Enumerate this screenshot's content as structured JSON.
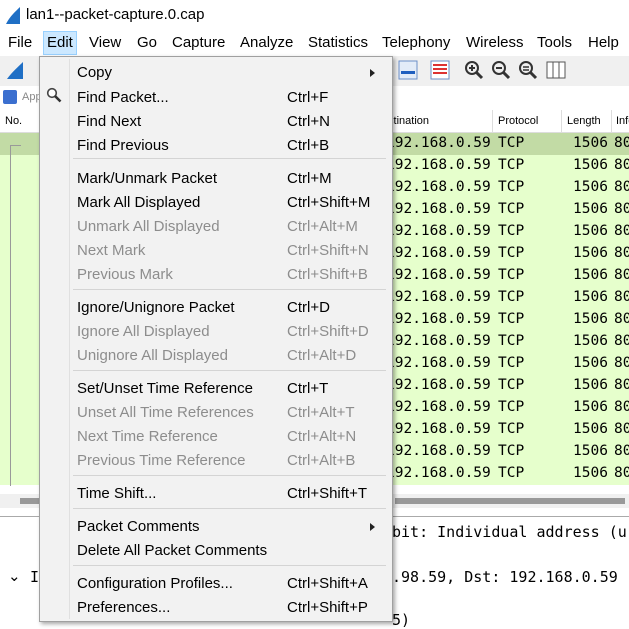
{
  "window": {
    "title": "lan1--packet-capture.0.cap"
  },
  "menubar": [
    "File",
    "Edit",
    "View",
    "Go",
    "Capture",
    "Analyze",
    "Statistics",
    "Telephony",
    "Wireless",
    "Tools",
    "Help"
  ],
  "filter": {
    "placeholder": "App"
  },
  "columns": {
    "no": "No.",
    "destination": "Destination",
    "protocol": "Protocol",
    "length": "Length",
    "info": "Info"
  },
  "packets": [
    {
      "dst": "192.168.0.59",
      "proto": "TCP",
      "len": "1506",
      "info": "80"
    },
    {
      "dst": "192.168.0.59",
      "proto": "TCP",
      "len": "1506",
      "info": "80"
    },
    {
      "dst": "192.168.0.59",
      "proto": "TCP",
      "len": "1506",
      "info": "80"
    },
    {
      "dst": "192.168.0.59",
      "proto": "TCP",
      "len": "1506",
      "info": "80"
    },
    {
      "dst": "192.168.0.59",
      "proto": "TCP",
      "len": "1506",
      "info": "80"
    },
    {
      "dst": "192.168.0.59",
      "proto": "TCP",
      "len": "1506",
      "info": "80"
    },
    {
      "dst": "192.168.0.59",
      "proto": "TCP",
      "len": "1506",
      "info": "80"
    },
    {
      "dst": "192.168.0.59",
      "proto": "TCP",
      "len": "1506",
      "info": "80"
    },
    {
      "dst": "192.168.0.59",
      "proto": "TCP",
      "len": "1506",
      "info": "80"
    },
    {
      "dst": "192.168.0.59",
      "proto": "TCP",
      "len": "1506",
      "info": "80"
    },
    {
      "dst": "192.168.0.59",
      "proto": "TCP",
      "len": "1506",
      "info": "80"
    },
    {
      "dst": "192.168.0.59",
      "proto": "TCP",
      "len": "1506",
      "info": "80"
    },
    {
      "dst": "192.168.0.59",
      "proto": "TCP",
      "len": "1506",
      "info": "80"
    },
    {
      "dst": "192.168.0.59",
      "proto": "TCP",
      "len": "1506",
      "info": "80"
    },
    {
      "dst": "192.168.0.59",
      "proto": "TCP",
      "len": "1506",
      "info": "80"
    },
    {
      "dst": "192.168.0.59",
      "proto": "TCP",
      "len": "1506",
      "info": "80"
    }
  ],
  "detail": {
    "line1": "bit: Individual address (u",
    "line2": "I",
    "line3": ".98.59, Dst: 192.168.0.59",
    "line4": "5)"
  },
  "edit_menu": [
    {
      "label": "Copy",
      "shortcut": "",
      "disabled": false,
      "submenu": true
    },
    {
      "label": "Find Packet...",
      "shortcut": "Ctrl+F",
      "disabled": false,
      "icon": "magnifier-icon"
    },
    {
      "label": "Find Next",
      "shortcut": "Ctrl+N",
      "disabled": false
    },
    {
      "label": "Find Previous",
      "shortcut": "Ctrl+B",
      "disabled": false
    },
    {
      "label": "Mark/Unmark Packet",
      "shortcut": "Ctrl+M",
      "disabled": false
    },
    {
      "label": "Mark All Displayed",
      "shortcut": "Ctrl+Shift+M",
      "disabled": false
    },
    {
      "label": "Unmark All Displayed",
      "shortcut": "Ctrl+Alt+M",
      "disabled": true
    },
    {
      "label": "Next Mark",
      "shortcut": "Ctrl+Shift+N",
      "disabled": true
    },
    {
      "label": "Previous Mark",
      "shortcut": "Ctrl+Shift+B",
      "disabled": true
    },
    {
      "label": "Ignore/Unignore Packet",
      "shortcut": "Ctrl+D",
      "disabled": false
    },
    {
      "label": "Ignore All Displayed",
      "shortcut": "Ctrl+Shift+D",
      "disabled": true
    },
    {
      "label": "Unignore All Displayed",
      "shortcut": "Ctrl+Alt+D",
      "disabled": true
    },
    {
      "label": "Set/Unset Time Reference",
      "shortcut": "Ctrl+T",
      "disabled": false
    },
    {
      "label": "Unset All Time References",
      "shortcut": "Ctrl+Alt+T",
      "disabled": true
    },
    {
      "label": "Next Time Reference",
      "shortcut": "Ctrl+Alt+N",
      "disabled": true
    },
    {
      "label": "Previous Time Reference",
      "shortcut": "Ctrl+Alt+B",
      "disabled": true
    },
    {
      "label": "Time Shift...",
      "shortcut": "Ctrl+Shift+T",
      "disabled": false
    },
    {
      "label": "Packet Comments",
      "shortcut": "",
      "disabled": false,
      "submenu": true
    },
    {
      "label": "Delete All Packet Comments",
      "shortcut": "",
      "disabled": false
    },
    {
      "label": "Configuration Profiles...",
      "shortcut": "Ctrl+Shift+A",
      "disabled": false
    },
    {
      "label": "Preferences...",
      "shortcut": "Ctrl+Shift+P",
      "disabled": false
    }
  ]
}
